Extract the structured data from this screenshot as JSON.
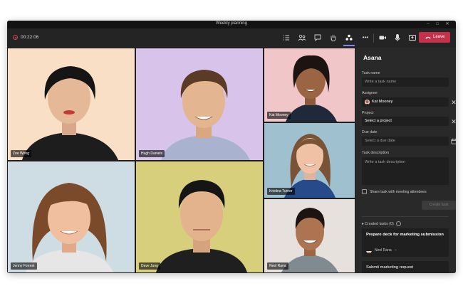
{
  "window": {
    "title": "Weekly planning",
    "controls": {
      "minimize": "–",
      "maximize": "□",
      "close": "✕"
    }
  },
  "toolbar": {
    "timer": "00:22:06",
    "icons": [
      "record-icon",
      "participants-list-icon",
      "people-icon",
      "chat-icon",
      "raise-hand-icon",
      "apps-icon",
      "more-icon",
      "camera-icon",
      "microphone-icon",
      "share-screen-icon"
    ],
    "more_label": "•••",
    "leave_label": "Leave",
    "leave_color": "#c4314b",
    "accent_color": "#7f85f5"
  },
  "participants": [
    {
      "name": "Zoe Wong",
      "bg": "#f8dfc6"
    },
    {
      "name": "Hugh Daniels",
      "bg": "#d8c3ea"
    },
    {
      "name": "Kat Mooney",
      "bg": "#f1c6c8"
    },
    {
      "name": "Kristina Turner",
      "bg": "#9fc1cf"
    },
    {
      "name": "Jenny Forrest",
      "bg": "#cddde3"
    },
    {
      "name": "Dave Jung",
      "bg": "#d8cf7c"
    },
    {
      "name": "Neel Rana",
      "bg": "#e6e1dc"
    }
  ],
  "panel": {
    "title": "Asana",
    "task_name_label": "Task name",
    "task_name_placeholder": "Write a task name",
    "assignee_label": "Assignee",
    "assignee_value": "Kat Mooney",
    "project_label": "Project",
    "project_placeholder": "Select a project",
    "due_date_label": "Due date",
    "due_date_placeholder": "Select a due date",
    "description_label": "Task description",
    "description_placeholder": "Write a task description",
    "share_label": "Share task with meeting attendees",
    "create_button": "Create task",
    "created_tasks_label": "▸ Created tasks (0)",
    "tasks": [
      {
        "title": "Prepare deck for marketing submission",
        "owner": "Neel Rana"
      },
      {
        "title": "Submit marketing request",
        "owner": ""
      }
    ]
  }
}
